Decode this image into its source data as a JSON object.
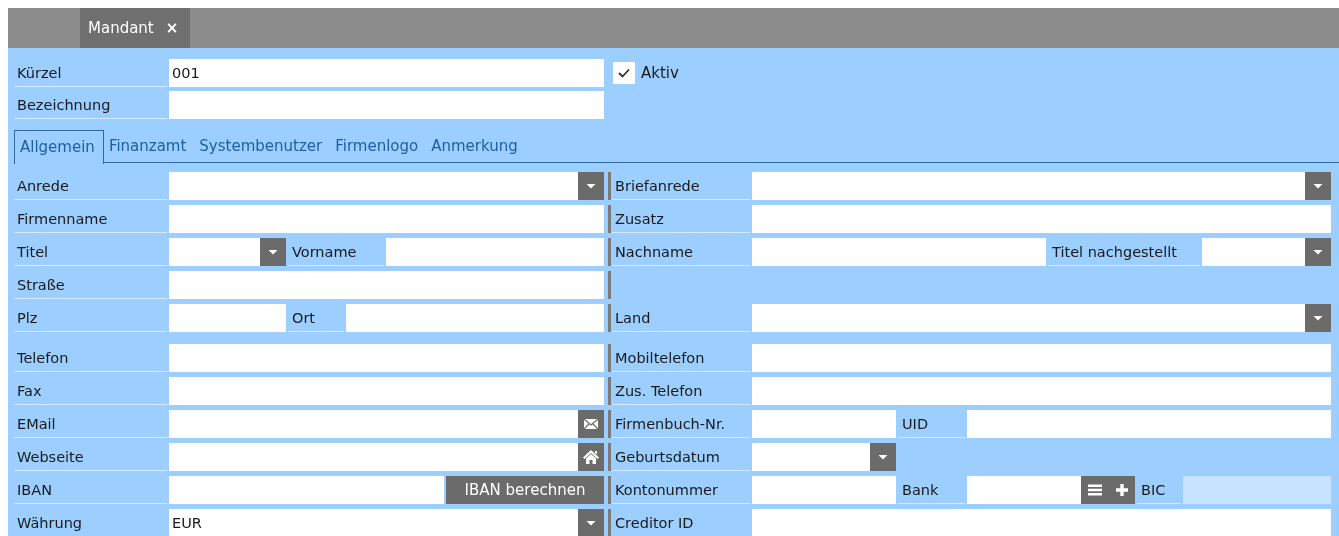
{
  "tabs": [
    {
      "label": "Mandant",
      "selected": true,
      "close": "×"
    }
  ],
  "header": {
    "rows": [
      {
        "segments": [
          {
            "kind": "label",
            "text": "Kürzel"
          },
          {
            "kind": "field",
            "value": "001"
          }
        ]
      },
      {
        "segments": [
          {
            "kind": "label",
            "text": "Bezeichnung"
          },
          {
            "kind": "field"
          }
        ]
      }
    ],
    "active": {
      "label": "Aktiv",
      "checked": true
    }
  },
  "sections": [
    {
      "label": "Allgemein",
      "selected": true
    },
    {
      "label": "Finanzamt",
      "selected": false
    },
    {
      "label": "Systembenutzer",
      "selected": false
    },
    {
      "label": "Firmenlogo",
      "selected": false
    },
    {
      "label": "Anmerkung",
      "selected": false
    }
  ],
  "groups": [
    {
      "rows": [
        {
          "left": [
            {
              "kind": "label",
              "text": "Anrede"
            },
            {
              "kind": "combo"
            }
          ],
          "right": [
            {
              "kind": "label",
              "text": "Briefanrede"
            },
            {
              "kind": "combo"
            }
          ]
        },
        {
          "left": [
            {
              "kind": "label",
              "text": "Firmenname"
            },
            {
              "kind": "field"
            }
          ],
          "right": [
            {
              "kind": "label",
              "text": "Zusatz"
            },
            {
              "kind": "field"
            }
          ]
        },
        {
          "left": [
            {
              "kind": "label",
              "text": "Titel"
            },
            {
              "kind": "combo"
            },
            {
              "kind": "label",
              "text": "Vorname"
            },
            {
              "kind": "field"
            }
          ],
          "right": [
            {
              "kind": "label",
              "text": "Nachname"
            },
            {
              "kind": "field"
            },
            {
              "kind": "label",
              "text": "Titel nachgestellt"
            },
            {
              "kind": "combo"
            }
          ]
        },
        {
          "left": [
            {
              "kind": "label",
              "text": "Straße"
            },
            {
              "kind": "field"
            }
          ],
          "right": []
        },
        {
          "left": [
            {
              "kind": "label",
              "text": "Plz"
            },
            {
              "kind": "field"
            },
            {
              "kind": "label",
              "text": "Ort"
            },
            {
              "kind": "field"
            }
          ],
          "right": [
            {
              "kind": "label",
              "text": "Land"
            },
            {
              "kind": "combo"
            }
          ]
        }
      ]
    },
    {
      "rows": [
        {
          "left": [
            {
              "kind": "label",
              "text": "Telefon"
            },
            {
              "kind": "field"
            }
          ],
          "right": [
            {
              "kind": "label",
              "text": "Mobiltelefon"
            },
            {
              "kind": "field"
            }
          ]
        },
        {
          "left": [
            {
              "kind": "label",
              "text": "Fax"
            },
            {
              "kind": "field"
            }
          ],
          "right": [
            {
              "kind": "label",
              "text": "Zus. Telefon"
            },
            {
              "kind": "field"
            }
          ]
        },
        {
          "left": [
            {
              "kind": "label",
              "text": "EMail"
            },
            {
              "kind": "mail-field"
            }
          ],
          "right": [
            {
              "kind": "label",
              "text": "Firmenbuch-Nr."
            },
            {
              "kind": "field"
            },
            {
              "kind": "label",
              "text": "UID"
            },
            {
              "kind": "field"
            }
          ]
        },
        {
          "left": [
            {
              "kind": "label",
              "text": "Webseite"
            },
            {
              "kind": "web-field"
            }
          ],
          "right": [
            {
              "kind": "label",
              "text": "Geburtsdatum"
            },
            {
              "kind": "combo"
            }
          ]
        },
        {
          "left": [
            {
              "kind": "label",
              "text": "IBAN"
            },
            {
              "kind": "field"
            },
            {
              "kind": "button",
              "text": "IBAN berechnen"
            }
          ],
          "right": [
            {
              "kind": "label",
              "text": "Kontonummer"
            },
            {
              "kind": "field"
            },
            {
              "kind": "label",
              "text": "Bank"
            },
            {
              "kind": "bank-field"
            },
            {
              "kind": "label",
              "text": "BIC"
            },
            {
              "kind": "field",
              "disabled": true
            }
          ]
        },
        {
          "left": [
            {
              "kind": "label",
              "text": "Währung"
            },
            {
              "kind": "combo",
              "value": "EUR"
            }
          ],
          "right": [
            {
              "kind": "label",
              "text": "Creditor ID"
            },
            {
              "kind": "field"
            }
          ]
        }
      ]
    }
  ]
}
